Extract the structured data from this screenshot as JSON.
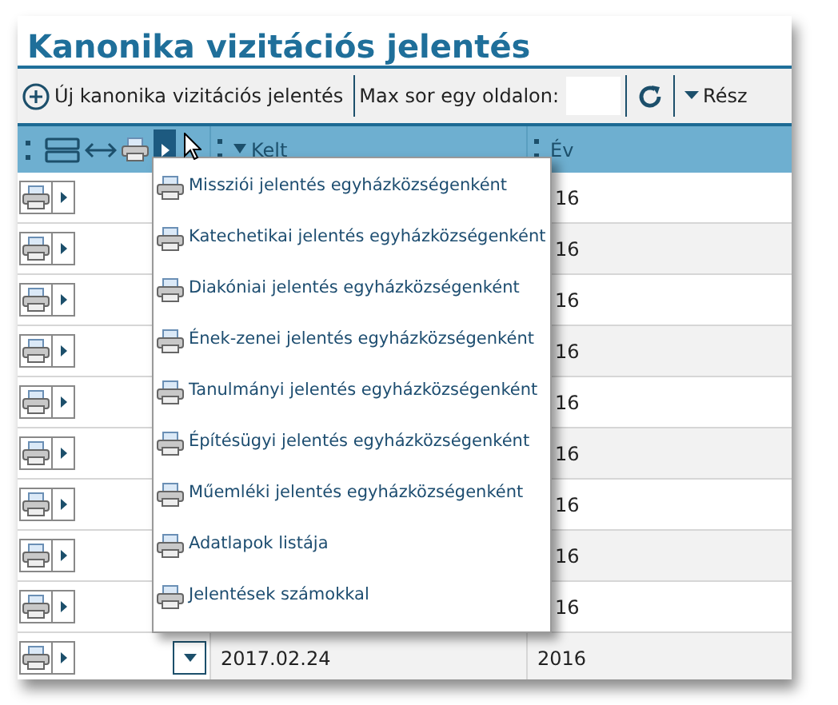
{
  "title": "Kanonika vizitációs jelentés",
  "toolbar": {
    "new_button": "Új kanonika vizitációs jelentés",
    "page_size_label": "Max sor egy oldalon:",
    "detail_label": "Rész"
  },
  "header": {
    "columns": [
      {
        "label": "Kelt",
        "sorted": true
      },
      {
        "label": "Év",
        "sorted": false
      }
    ],
    "print_menu_open": true
  },
  "menu": {
    "items": [
      {
        "label": "Missziói jelentés egyházközségenként"
      },
      {
        "label": "Katechetikai jelentés egyházközségenként"
      },
      {
        "label": "Diakóniai jelentés egyházközségenként"
      },
      {
        "label": "Ének-zenei jelentés egyházközségenként"
      },
      {
        "label": "Tanulmányi jelentés egyházközségenként"
      },
      {
        "label": "Építésügyi jelentés egyházközségenként"
      },
      {
        "label": "Műemléki jelentés egyházközségenként"
      },
      {
        "label": "Adatlapok listája"
      },
      {
        "label": "Jelentések számokkal"
      }
    ]
  },
  "rows": [
    {
      "year": "16"
    },
    {
      "year": "16"
    },
    {
      "year": "16"
    },
    {
      "year": "16"
    },
    {
      "year": "16"
    },
    {
      "year": "16"
    },
    {
      "year": "16"
    },
    {
      "year": "16"
    },
    {
      "year": "16"
    },
    {
      "date": "2017.02.24",
      "year": "2016"
    }
  ]
}
